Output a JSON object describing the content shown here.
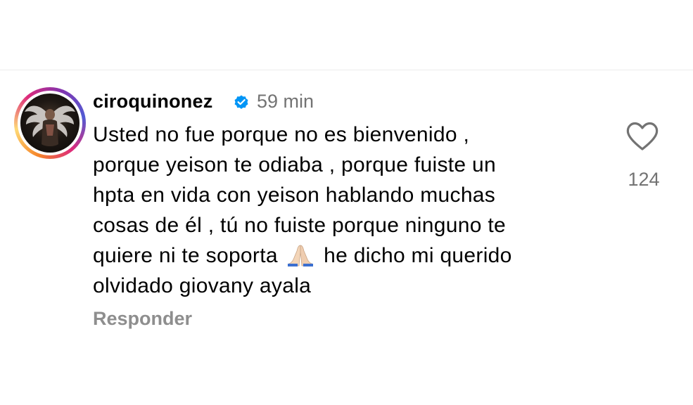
{
  "comment": {
    "username": "ciroquinonez",
    "verified": true,
    "timestamp": "59 min",
    "lines": [
      "Usted no fue porque no es bienvenido ,",
      "porque yeison te odiaba , porque fuiste un",
      "hpta en vida con yeison hablando muchas",
      "cosas de él , tú no fuiste porque ninguno te"
    ],
    "line5_before_emoji": "quiere ni te soporta",
    "line5_emoji": "folded-hands-emoji",
    "line5_after_emoji": "he dicho mi querido",
    "line6": "olvidado giovany ayala",
    "reply_label": "Responder",
    "like_count": "124"
  },
  "colors": {
    "verified_badge": "#0095f6",
    "muted_text": "#737373",
    "reply_text": "#8e8e8e"
  },
  "icons": {
    "like": "heart-outline-icon",
    "verified": "verified-badge-icon"
  }
}
